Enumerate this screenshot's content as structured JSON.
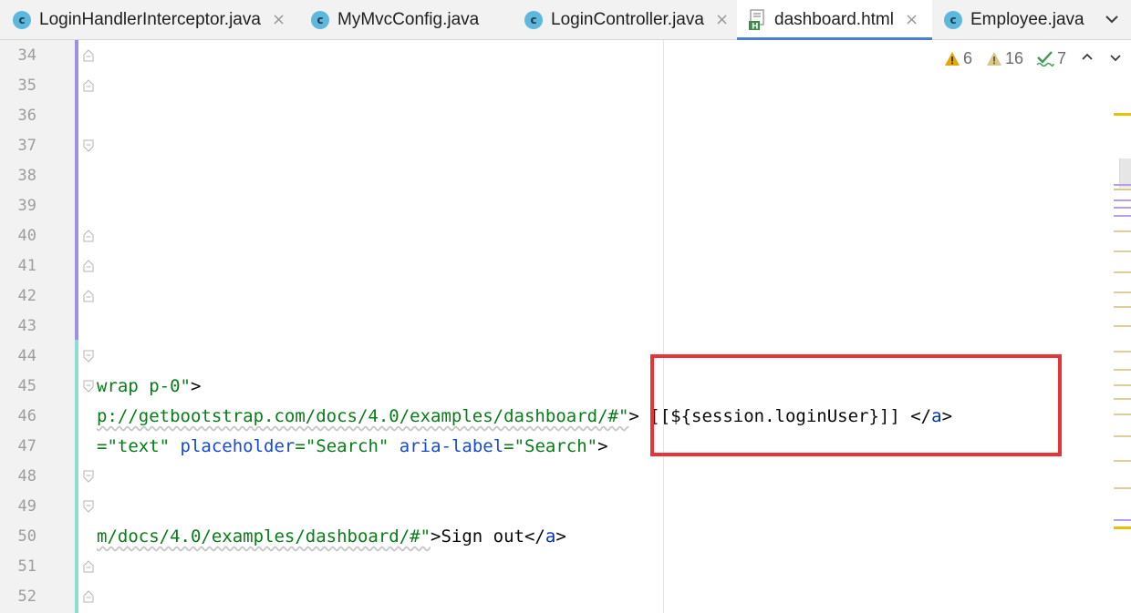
{
  "tabs": [
    {
      "label": "LoginHandlerInterceptor.java",
      "icon": "java-class-icon",
      "icon_letter": "c",
      "active": false,
      "closable": true
    },
    {
      "label": "MyMvcConfig.java",
      "icon": "java-class-icon",
      "icon_letter": "c",
      "active": false,
      "closable": false
    },
    {
      "label": "LoginController.java",
      "icon": "java-class-icon",
      "icon_letter": "c",
      "active": false,
      "closable": true
    },
    {
      "label": "dashboard.html",
      "icon": "html-file-icon",
      "icon_letter": "H",
      "active": true,
      "closable": true
    },
    {
      "label": "Employee.java",
      "icon": "java-class-icon",
      "icon_letter": "c",
      "active": false,
      "closable": false
    }
  ],
  "tab_close_glyph": "×",
  "inspections": {
    "warnings": "6",
    "weak_warnings": "16",
    "typos": "7",
    "warning_color": "#e6a700",
    "weak_color": "#c9b26b",
    "typo_color": "#3e9a4f"
  },
  "line_numbers": [
    "34",
    "35",
    "36",
    "37",
    "38",
    "39",
    "40",
    "41",
    "42",
    "43",
    "44",
    "45",
    "46",
    "47",
    "48",
    "49",
    "50",
    "51",
    "52"
  ],
  "code": {
    "line45": {
      "a": "wrap p-0\"",
      "b": ">"
    },
    "line46": {
      "a": "p://getbootstrap.com/docs/4.0/examples/dashboard/#\"",
      "b": "> [[${session.loginUser}]] </",
      "c": "a",
      "d": ">"
    },
    "line47": {
      "a": "=\"text\"",
      "b": " ",
      "c": "placeholder",
      "d": "=\"Search\"",
      "e": " ",
      "f": "aria-label",
      "g": "=\"Search\"",
      "h": ">"
    },
    "line50": {
      "a": "m/docs/4.0/examples/dashboard/#\"",
      "b": ">Sign out</",
      "c": "a",
      "d": ">"
    }
  },
  "colors": {
    "highlight_box": "#e83437",
    "string": "#067d17",
    "attribute": "#174ad4",
    "tag": "#0033b3",
    "active_tab_underline": "#4a7fd4"
  }
}
